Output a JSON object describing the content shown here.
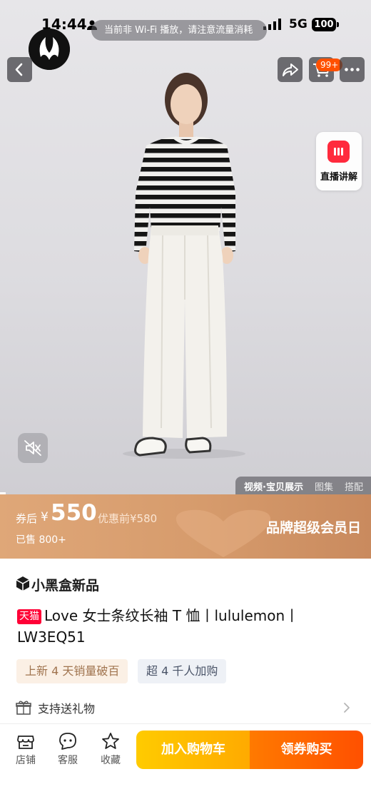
{
  "status_bar": {
    "time": "14:44",
    "network": "5G",
    "battery": "100"
  },
  "notice_banner": "当前非 Wi-Fi 播放，请注意流量消耗",
  "header": {
    "cart_badge": "99+"
  },
  "live_button": {
    "label": "直播讲解"
  },
  "media_tabs": [
    {
      "label": "视频·宝贝展示",
      "active": true
    },
    {
      "label": "图集",
      "active": false
    },
    {
      "label": "搭配",
      "active": false
    }
  ],
  "price_band": {
    "coupon_after": "券后",
    "currency": "¥",
    "price": "550",
    "before_coupon": "优惠前¥580",
    "sold": "已售 800+",
    "brand_day": "品牌超级会员日"
  },
  "product": {
    "box_badge": "小黑盒新品",
    "tmall_tag": "天猫",
    "title": "Love 女士条纹长袖 T 恤丨lululemon丨LW3EQ51",
    "tags": [
      "上新 4 天销量破百",
      "超 4 千人加购"
    ],
    "gift": "支持送礼物"
  },
  "bottom_bar": {
    "store": "店铺",
    "service": "客服",
    "favorite": "收藏",
    "add_to_cart": "加入购物车",
    "buy_with_coupon": "领券购买"
  },
  "colors": {
    "accent_orange": "#ff5000",
    "accent_yellow": "#ffaa00",
    "tmall_red": "#ff0036",
    "price_band": "#d69b6c"
  },
  "video_progress": 0.015
}
